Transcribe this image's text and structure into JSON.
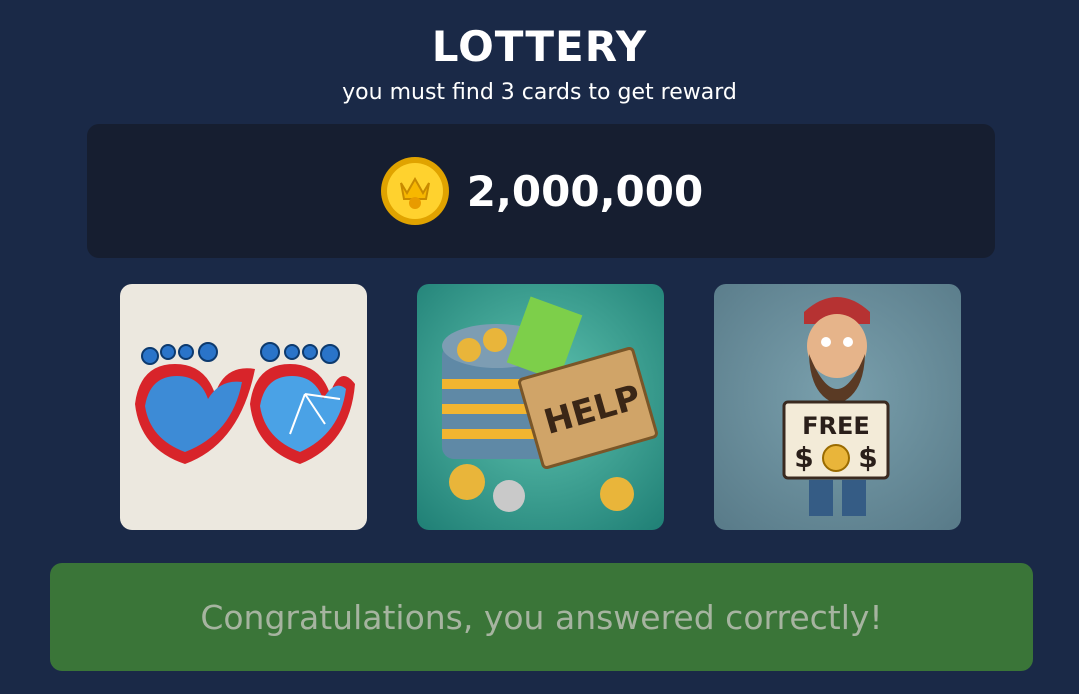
{
  "header": {
    "title": "LOTTERY",
    "subtitle": "you must find 3 cards to get reward"
  },
  "prize": {
    "icon": "gold-coin-icon",
    "amount": "2,000,000"
  },
  "cards": [
    {
      "icon": "broken-heart-glasses"
    },
    {
      "icon": "help-can-with-money",
      "sign_text": "HELP"
    },
    {
      "icon": "homeless-man-with-sign",
      "sign_text": "FREE",
      "sign_text2": "$",
      "sign_text3": "$"
    }
  ],
  "result": {
    "message": "Congratulations, you answered correctly!"
  },
  "colors": {
    "background": "#1a2947",
    "panel": "#161e30",
    "success": "#3a7538",
    "success_text": "#a6b4a0"
  }
}
